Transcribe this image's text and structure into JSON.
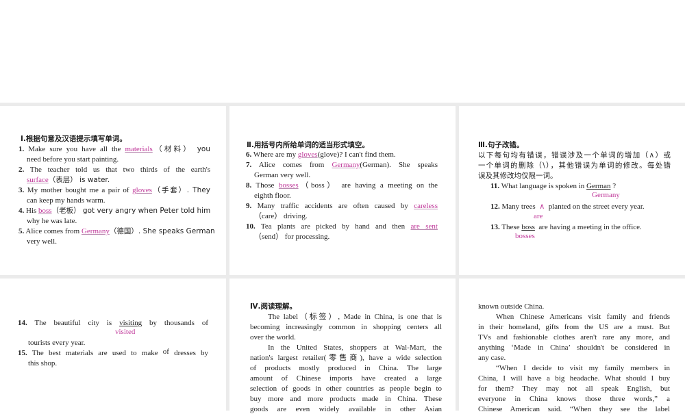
{
  "section1": {
    "title": "Ⅰ.根据句意及汉语提示填写单词。",
    "items": [
      {
        "n": "1.",
        "a": "Make sure you have all the ",
        "ans": "materials",
        "b": "（材料） you",
        "c": "need before you start painting."
      },
      {
        "n": "2.",
        "a": "The teacher told us that two thirds of the earth's",
        "ans": "surface",
        "b": "（表层） is water."
      },
      {
        "n": "3.",
        "a": "My mother bought me a pair of ",
        "ans": "gloves",
        "b": "（手套）. They",
        "c": "can keep my hands warm."
      },
      {
        "n": "4.",
        "a": "His ",
        "ans": "boss",
        "b": "（老板） got very angry when Peter told him",
        "c": "why he was late."
      },
      {
        "n": "5.",
        "a": "Alice comes from ",
        "ans": "Germany",
        "b": "（德国）. She speaks German",
        "c": "very well."
      }
    ]
  },
  "section2": {
    "title": "Ⅱ.用括号内所给单词的适当形式填空。",
    "items": [
      {
        "n": "6.",
        "a": "Where are my ",
        "ans": "gloves",
        "b": "(glove)? I can't find them."
      },
      {
        "n": "7.",
        "a": "Alice comes from ",
        "ans": "Germany",
        "b": "(German). She speaks",
        "c": "German very well."
      },
      {
        "n": "8.",
        "a": "Those ",
        "ans": "bosses",
        "b": "（boss） are having a meeting on the",
        "c": "eighth floor."
      },
      {
        "n": "9.",
        "a": "Many traffic accidents are often caused by ",
        "ans": "careless",
        "c": "（care） driving."
      },
      {
        "n": "10.",
        "a": "Tea plants are picked by hand and then ",
        "ans": "are sent",
        "c": "（send） for processing."
      }
    ]
  },
  "section3": {
    "title": "Ⅲ.句子改错。",
    "instructions": [
      "以下每句均有错误，错误涉及一个单词的增加（∧）或",
      "一个单词的删除（\\），其他错误为单词的修改。每处错",
      "误及其修改均仅限一词。"
    ],
    "items": [
      {
        "n": "11.",
        "a": "What language is spoken in ",
        "err": "German",
        "b": "?",
        "fix": "Germany"
      },
      {
        "n": "12.",
        "a": "Many trees ",
        "err": "∧",
        "b": "planted on the street every year.",
        "fix": "are"
      },
      {
        "n": "13.",
        "a": "These ",
        "err": "boss",
        "b": "are having a meeting in the office.",
        "fix": "bosses"
      },
      {
        "n": "14.",
        "a": "The beautiful city is ",
        "err": "visiting",
        "b": "by thousands of",
        "c": "tourists every year.",
        "fix": "visited"
      },
      {
        "n": "15.",
        "a": "The best materials are used to make ",
        "err": "of",
        "b": "dresses by",
        "c": "this shop."
      }
    ]
  },
  "section4": {
    "title": "Ⅳ.阅读理解。",
    "col1": [
      "The label（标签）, Made in China, is one that is",
      "becoming increasingly common in shopping centers all",
      "over the world.",
      "In the United States, shoppers at Wal-Mart, the",
      "nation's largest retailer(零售商), have a wide selection",
      "of products mostly produced in China. The large",
      "amount of Chinese imports have created a large",
      "selection of goods in other countries as people begin to",
      "buy more and more products made in China. These",
      "goods are even widely available in other Asian"
    ],
    "col2": [
      "known outside China.",
      "When Chinese Americans visit family and friends",
      "in their homeland, gifts from the US are a must. But",
      "TVs and fashionable clothes aren't rare any more, and",
      "anything ‘Made in China’ shouldn't be considered in",
      "any case.",
      "“When I decide to visit my family members in",
      "China, I will have a big headache. What should I buy",
      "for them? They may not all speak English, but",
      "everyone in China knows those three words,” a",
      "Chinese American said. “When they see the label"
    ]
  }
}
